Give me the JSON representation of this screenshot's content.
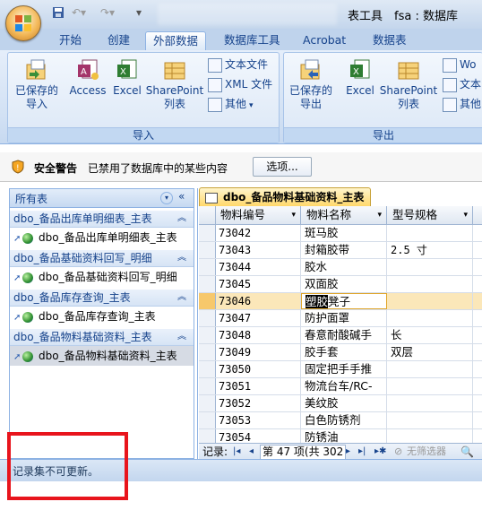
{
  "titlebar": {
    "title_left": "表工具",
    "title_right": "fsa : 数据库"
  },
  "tabs": [
    {
      "label": "开始"
    },
    {
      "label": "创建"
    },
    {
      "label": "外部数据"
    },
    {
      "label": "数据库工具"
    },
    {
      "label": "Acrobat"
    },
    {
      "label": "数据表"
    }
  ],
  "ribbon": {
    "import_group": {
      "label": "导入",
      "saved_import": [
        "已保存的",
        "导入"
      ],
      "access": "Access",
      "excel": "Excel",
      "sharepoint": [
        "SharePoint",
        "列表"
      ],
      "text_file": "文本文件",
      "xml_file": "XML 文件",
      "more": "其他"
    },
    "export_group": {
      "label": "导出",
      "saved_export": [
        "已保存的",
        "导出"
      ],
      "excel": "Excel",
      "sharepoint": [
        "SharePoint",
        "列表"
      ],
      "word": "Wo",
      "text": "文本",
      "more": "其他"
    }
  },
  "security": {
    "title": "安全警告",
    "message": "已禁用了数据库中的某些内容",
    "options_button": "选项..."
  },
  "nav": {
    "header": "所有表",
    "groups": [
      {
        "label": "dbo_备品出库单明细表_主表",
        "item": "dbo_备品出库单明细表_主表"
      },
      {
        "label": "dbo_备品基础资料回写_明细",
        "item": "dbo_备品基础资料回写_明细"
      },
      {
        "label": "dbo_备品库存查询_主表",
        "item": "dbo_备品库存查询_主表"
      },
      {
        "label": "dbo_备品物料基础资料_主表",
        "item": "dbo_备品物料基础资料_主表"
      }
    ]
  },
  "doc": {
    "tab_title": "dbo_备品物料基础资料_主表",
    "columns": [
      "物料编号",
      "物料名称",
      "型号规格"
    ],
    "rows": [
      {
        "id": "73042",
        "name": "斑马胶",
        "spec": ""
      },
      {
        "id": "73043",
        "name": "封箱胶带",
        "spec": "2.5 寸"
      },
      {
        "id": "73044",
        "name": "胶水",
        "spec": ""
      },
      {
        "id": "73045",
        "name": "双面胶",
        "spec": ""
      },
      {
        "id": "73046",
        "name": "塑胶凳子",
        "spec": ""
      },
      {
        "id": "73047",
        "name": "防护面罩",
        "spec": ""
      },
      {
        "id": "73048",
        "name": "春意耐酸碱手",
        "spec": "长"
      },
      {
        "id": "73049",
        "name": "胶手套",
        "spec": "双层"
      },
      {
        "id": "73050",
        "name": "固定把手手推",
        "spec": ""
      },
      {
        "id": "73051",
        "name": "物流台车/RC-",
        "spec": ""
      },
      {
        "id": "73052",
        "name": "美纹胶",
        "spec": ""
      },
      {
        "id": "73053",
        "name": "白色防锈剂",
        "spec": ""
      },
      {
        "id": "73054",
        "name": "防锈油",
        "spec": ""
      }
    ],
    "selected_text": "塑胶",
    "selected_rest": "凳子"
  },
  "recnav": {
    "label": "记录:",
    "position": "第 47 项(共 302",
    "filter": "无筛选器"
  },
  "status": {
    "text": "记录集不可更新。"
  },
  "colors": {
    "accent": "#15428b",
    "highlight_box": "#e8141c",
    "active_doc_tab": "#ffd86b"
  }
}
